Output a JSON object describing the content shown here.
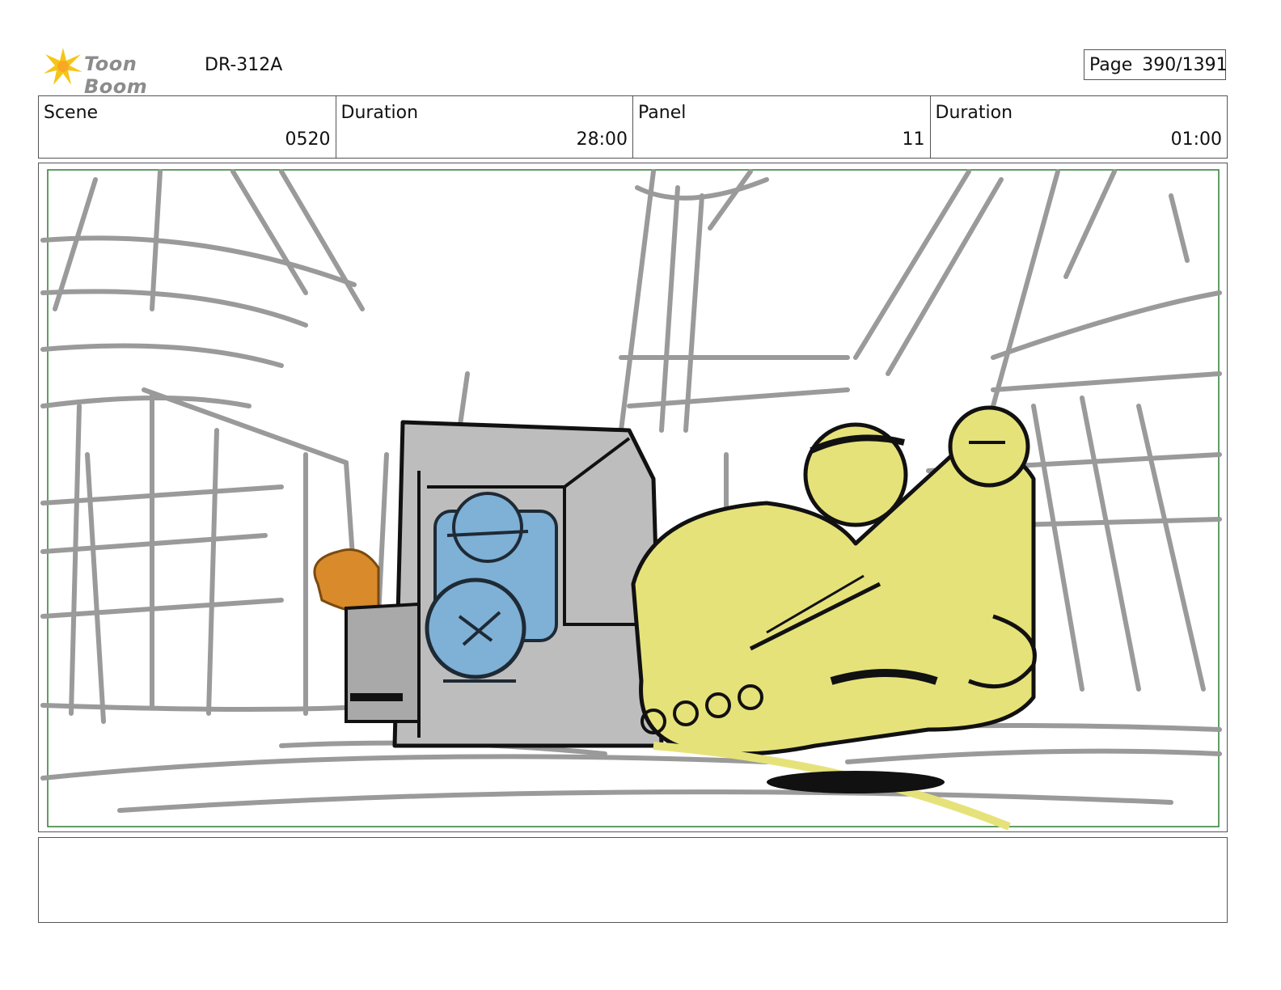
{
  "header": {
    "logo_text": "Toon Boom",
    "project_code": "DR-312A",
    "page_label": "Page",
    "page_value": "390/1391"
  },
  "info_table": [
    {
      "label": "Scene",
      "value": "0520"
    },
    {
      "label": "Duration",
      "value": "28:00"
    },
    {
      "label": "Panel",
      "value": "11"
    },
    {
      "label": "Duration",
      "value": "01:00"
    }
  ],
  "colors": {
    "sketch_gray": "#9a9a9a",
    "safe_frame": "#2e7d32",
    "yellow_character": "#e6e27a",
    "blue_character": "#7fb0d6",
    "orange_character": "#d98a2b",
    "crate_gray": "#bdbdbd",
    "logo_accent": "#f5c518"
  },
  "notes": {
    "text": ""
  }
}
